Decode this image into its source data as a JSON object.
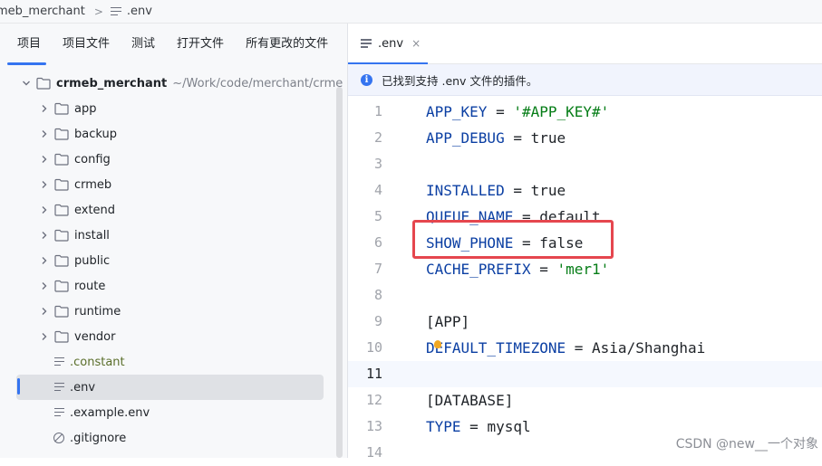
{
  "breadcrumb": {
    "project": "meb_merchant",
    "separator": ">",
    "file": ".env"
  },
  "project_tabs": [
    "项目",
    "项目文件",
    "测试",
    "打开文件",
    "所有更改的文件"
  ],
  "tree": {
    "root": {
      "name": "crmeb_merchant",
      "path": "~/Work/code/merchant/crme"
    },
    "folders": [
      "app",
      "backup",
      "config",
      "crmeb",
      "extend",
      "install",
      "public",
      "route",
      "runtime",
      "vendor"
    ],
    "files": [
      ".constant",
      ".env",
      ".example.env"
    ],
    "ignore_file": ".gitignore",
    "selected": ".env"
  },
  "editor": {
    "tab_label": ".env",
    "tab_close": "×",
    "notice_text": "已找到支持 .env 文件的插件。",
    "current_line": 11,
    "lines": [
      {
        "n": "1",
        "key": "APP_KEY",
        "eq": " = ",
        "value": "'#APP_KEY#'",
        "kind": "string"
      },
      {
        "n": "2",
        "key": "APP_DEBUG",
        "eq": " = ",
        "value": "true",
        "kind": "plain"
      },
      {
        "n": "3"
      },
      {
        "n": "4",
        "key": "INSTALLED",
        "eq": " = ",
        "value": "true",
        "kind": "plain"
      },
      {
        "n": "5",
        "key": "QUEUE_NAME",
        "eq": " = ",
        "value": "default",
        "kind": "plain"
      },
      {
        "n": "6",
        "key": "SHOW_PHONE",
        "eq": " = ",
        "value": "false",
        "kind": "plain"
      },
      {
        "n": "7",
        "key": "CACHE_PREFIX",
        "eq": " = ",
        "value": "'mer1'",
        "kind": "string"
      },
      {
        "n": "8"
      },
      {
        "n": "9",
        "section": "[APP]"
      },
      {
        "n": "10",
        "key": "DEFAULT_TIMEZONE",
        "eq": " = ",
        "value": "Asia/Shanghai",
        "kind": "plain"
      },
      {
        "n": "11"
      },
      {
        "n": "12",
        "section": "[DATABASE]"
      },
      {
        "n": "13",
        "key": "TYPE",
        "eq": " = ",
        "value": "mysql",
        "kind": "plain"
      },
      {
        "n": "14"
      }
    ]
  },
  "watermark": "CSDN @new__一个对象",
  "colors": {
    "accent": "#3574f0",
    "highlight": "#e5464e",
    "key": "#0b3fa3",
    "string": "#067d17"
  }
}
